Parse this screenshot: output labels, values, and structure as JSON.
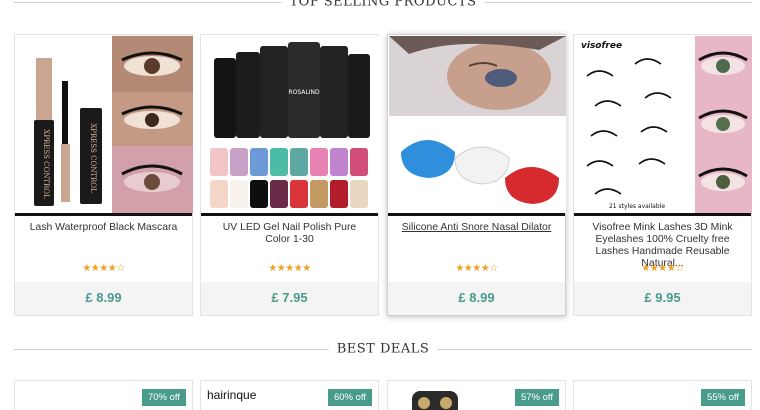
{
  "top_section": {
    "title": "TOP SELLING PRODUCTS"
  },
  "products": [
    {
      "name": "Lash Waterproof Black Mascara",
      "price": "£ 8.99",
      "rating": "★★★★☆",
      "image": "mascara-product-photo"
    },
    {
      "name": "UV LED Gel Nail Polish Pure Color 1-30",
      "price": "£ 7.95",
      "rating": "★★★★★",
      "image": "nail-polish-product-photo"
    },
    {
      "name": "Silicone Anti Snore Nasal Dilator",
      "price": "£ 8.99",
      "rating": "★★★★☆",
      "image": "anti-snore-product-photo"
    },
    {
      "name": "Visofree Mink Lashes 3D Mink Eyelashes 100% Cruelty free Lashes Handmade Reusable Natural...",
      "price": "£ 9.95",
      "rating": "★★★★☆",
      "image": "mink-lashes-product-photo",
      "image_brand": "visofree",
      "image_caption": "21 styles available"
    }
  ],
  "deals_section": {
    "title": "BEST DEALS"
  },
  "deals": [
    {
      "discount": "70% off"
    },
    {
      "discount": "60% off",
      "brand": "hairinque"
    },
    {
      "discount": "57% off"
    },
    {
      "discount": "55% off"
    }
  ],
  "colors": {
    "accent": "#4a9c8a",
    "stars": "#f0a020",
    "price_bar": "#f4f4f4"
  }
}
